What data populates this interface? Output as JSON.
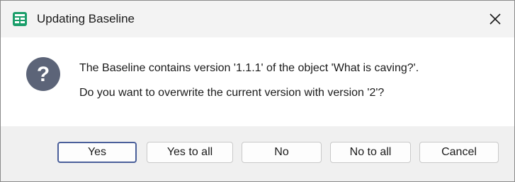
{
  "window": {
    "title": "Updating Baseline",
    "app_icon": "table-window-icon",
    "close_icon": "close-icon"
  },
  "message": {
    "icon": "question-icon",
    "line1": "The Baseline contains version '1.1.1' of the object 'What is caving?'.",
    "line2": "Do you want to overwrite the current version with version '2'?"
  },
  "buttons": {
    "yes": "Yes",
    "yes_to_all": "Yes to all",
    "no": "No",
    "no_to_all": "No to all",
    "cancel": "Cancel"
  },
  "colors": {
    "app_icon": "#1a9e6a",
    "question_icon": "#5c6478",
    "default_button_border": "#4a5f9a",
    "footer_background": "#f0f0f0"
  }
}
